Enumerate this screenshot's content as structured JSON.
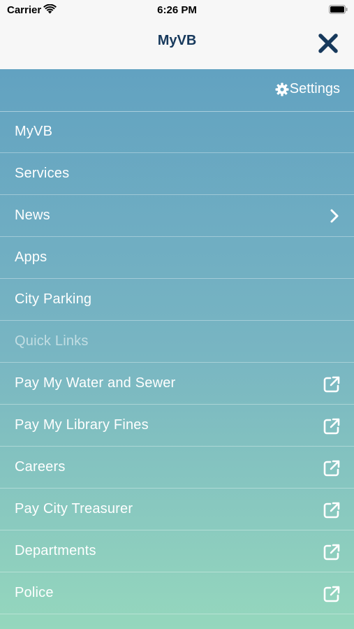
{
  "status_bar": {
    "carrier": "Carrier",
    "time": "6:26 PM"
  },
  "header": {
    "title": "MyVB",
    "close_icon": "close-icon"
  },
  "colors": {
    "title": "#17395c",
    "gradient_top": "#62a2c1",
    "gradient_bottom": "#95d7bd"
  },
  "menu": {
    "settings_label": "Settings",
    "items": [
      {
        "label": "MyVB",
        "icon": ""
      },
      {
        "label": "Services",
        "icon": ""
      },
      {
        "label": "News",
        "icon": "chevron-right-icon"
      },
      {
        "label": "Apps",
        "icon": ""
      },
      {
        "label": "City Parking",
        "icon": ""
      },
      {
        "label": "Quick Links",
        "icon": "",
        "muted": true
      },
      {
        "label": "Pay My Water and Sewer",
        "icon": "external-link-icon"
      },
      {
        "label": "Pay My Library Fines",
        "icon": "external-link-icon"
      },
      {
        "label": "Careers",
        "icon": "external-link-icon"
      },
      {
        "label": "Pay City Treasurer",
        "icon": "external-link-icon"
      },
      {
        "label": "Departments",
        "icon": "external-link-icon"
      },
      {
        "label": "Police",
        "icon": "external-link-icon"
      }
    ]
  }
}
